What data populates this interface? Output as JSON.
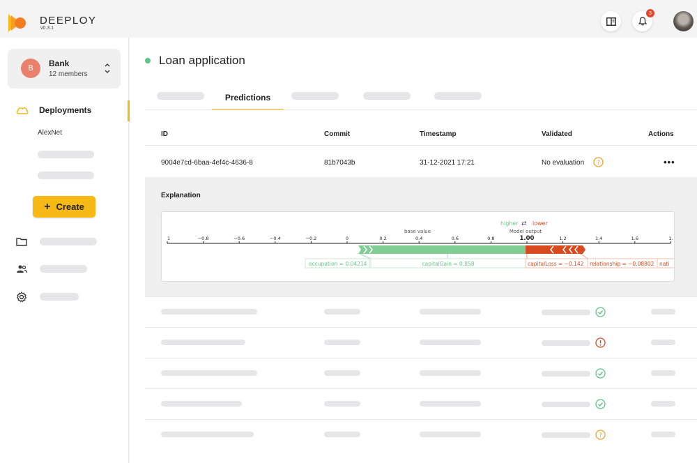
{
  "app": {
    "name": "DEEPLOY",
    "version": "v0.3.1",
    "notification_count": "3",
    "colors": {
      "accent": "#f6b916",
      "success": "#5cc486",
      "danger": "#d84a20",
      "warning": "#f0a030"
    }
  },
  "sidebar": {
    "org": {
      "initial": "B",
      "name": "Bank",
      "members": "12 members"
    },
    "nav": {
      "deployments": "Deployments",
      "active_sub": "AlexNet"
    },
    "create_label": "Create",
    "icons": [
      "cloud-icon",
      "folder-icon",
      "people-icon",
      "gear-icon"
    ]
  },
  "page": {
    "title": "Loan application",
    "active_tab": "Predictions"
  },
  "table": {
    "headers": {
      "id": "ID",
      "commit": "Commit",
      "timestamp": "Timestamp",
      "validated": "Validated",
      "actions": "Actions"
    },
    "row": {
      "id": "9004e7cd-6baa-4ef4c-4636-8",
      "commit": "81b7043b",
      "timestamp": "31-12-2021 17:21",
      "validated": "No evaluation",
      "actions": "•••"
    },
    "placeholder_row_status": [
      "check",
      "error",
      "check",
      "check",
      "question"
    ]
  },
  "explanation": {
    "title": "Explanation",
    "higher_label": "higher",
    "arrows": "⇄",
    "lower_label": "lower",
    "model_output_label": "Model output",
    "model_output_value": "1.00",
    "base_value_label": "base value",
    "axis_ticks": [
      "1",
      "−0.8",
      "−0.6",
      "−0.4",
      "−0.2",
      "0",
      "0.2",
      "0.4",
      "0.6",
      "0.8",
      "1.00",
      "1.2",
      "1.4",
      "1.6",
      "1."
    ],
    "features_positive": [
      "occupation = 0.04214",
      "capitalGain = 0.858"
    ],
    "features_negative": [
      "capitalLoss = −0.142",
      "relationship = −0.08802",
      "nati"
    ]
  }
}
